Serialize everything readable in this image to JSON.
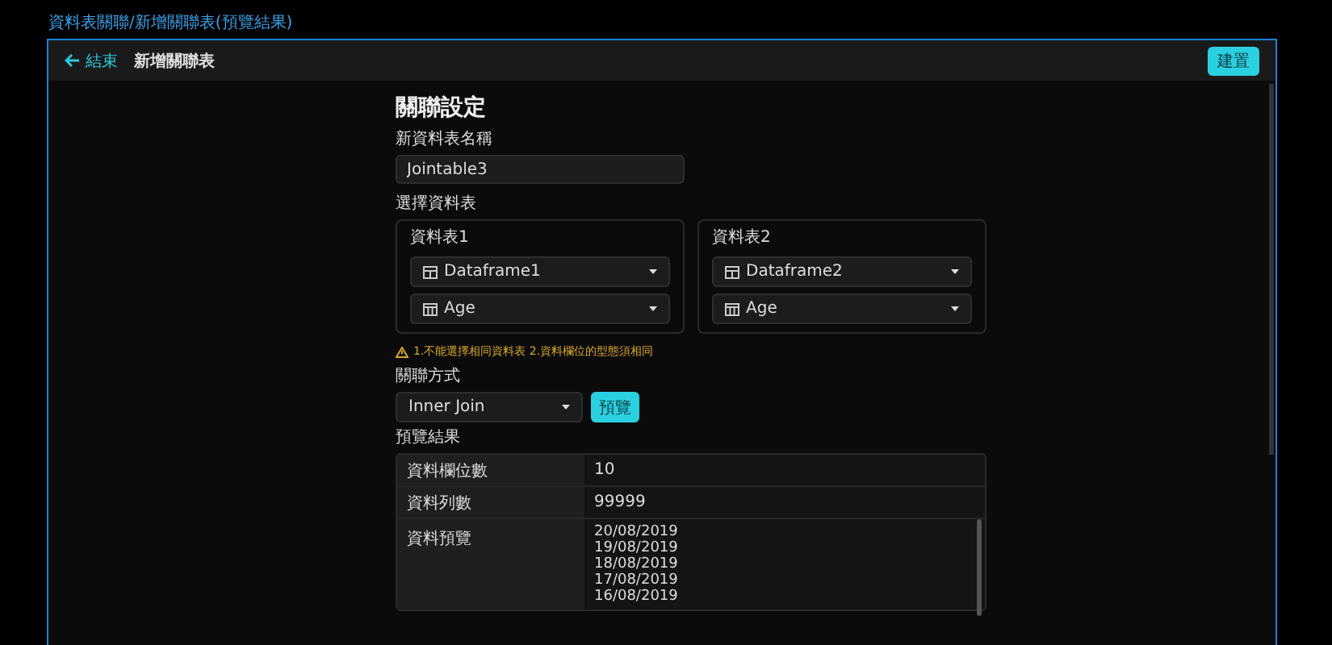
{
  "breadcrumb": "資料表關聯/新增關聯表(預覽結果)",
  "header": {
    "back": "結束",
    "title": "新增關聯表",
    "action": "建置"
  },
  "section_title": "關聯設定",
  "name_field": {
    "label": "新資料表名稱",
    "value": "Jointable3"
  },
  "select_label": "選擇資料表",
  "tables": [
    {
      "label": "資料表1",
      "table": "Dataframe1",
      "column": "Age"
    },
    {
      "label": "資料表2",
      "table": "Dataframe2",
      "column": "Age"
    }
  ],
  "warning": "1.不能選擇相同資料表  2.資料欄位的型態須相同",
  "join": {
    "label": "關聯方式",
    "value": "Inner Join",
    "button": "預覽"
  },
  "result": {
    "label": "預覽結果",
    "rows": [
      {
        "key": "資料欄位數",
        "value": "10"
      },
      {
        "key": "資料列數",
        "value": "99999"
      }
    ],
    "preview_key": "資料預覽",
    "preview_lines": [
      "20/08/2019",
      "19/08/2019",
      "18/08/2019",
      "17/08/2019",
      "16/08/2019"
    ]
  }
}
